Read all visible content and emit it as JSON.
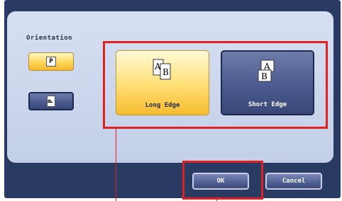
{
  "orientation": {
    "label": "Orientation",
    "portrait_glyph": "P",
    "landscape_glyph": "P"
  },
  "binding": {
    "long_edge_label": "Long Edge",
    "short_edge_label": "Short Edge",
    "long_edge_glyphs": [
      "A",
      "B"
    ],
    "short_edge_glyphs": [
      "A",
      "B"
    ]
  },
  "footer": {
    "ok_label": "OK",
    "cancel_label": "Cancel"
  },
  "colors": {
    "highlight": "#e02121",
    "selected": "#ffd65a",
    "panel": "#c3cfe8",
    "frame": "#2a3b63"
  }
}
